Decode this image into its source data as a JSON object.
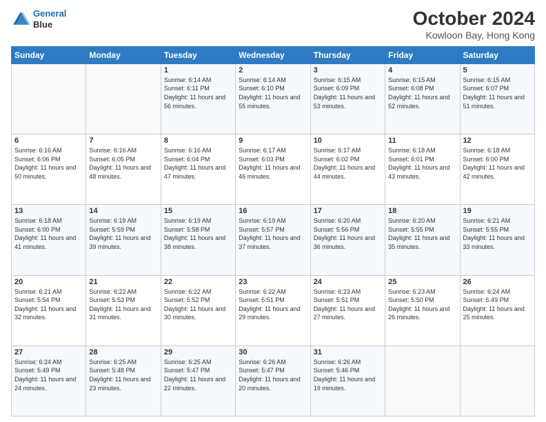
{
  "header": {
    "logo_line1": "General",
    "logo_line2": "Blue",
    "month_title": "October 2024",
    "location": "Kowloon Bay, Hong Kong"
  },
  "days_of_week": [
    "Sunday",
    "Monday",
    "Tuesday",
    "Wednesday",
    "Thursday",
    "Friday",
    "Saturday"
  ],
  "weeks": [
    [
      {
        "day": "",
        "info": ""
      },
      {
        "day": "",
        "info": ""
      },
      {
        "day": "1",
        "info": "Sunrise: 6:14 AM\nSunset: 6:11 PM\nDaylight: 11 hours and 56 minutes."
      },
      {
        "day": "2",
        "info": "Sunrise: 6:14 AM\nSunset: 6:10 PM\nDaylight: 11 hours and 55 minutes."
      },
      {
        "day": "3",
        "info": "Sunrise: 6:15 AM\nSunset: 6:09 PM\nDaylight: 11 hours and 53 minutes."
      },
      {
        "day": "4",
        "info": "Sunrise: 6:15 AM\nSunset: 6:08 PM\nDaylight: 11 hours and 52 minutes."
      },
      {
        "day": "5",
        "info": "Sunrise: 6:15 AM\nSunset: 6:07 PM\nDaylight: 11 hours and 51 minutes."
      }
    ],
    [
      {
        "day": "6",
        "info": "Sunrise: 6:16 AM\nSunset: 6:06 PM\nDaylight: 11 hours and 50 minutes."
      },
      {
        "day": "7",
        "info": "Sunrise: 6:16 AM\nSunset: 6:05 PM\nDaylight: 11 hours and 48 minutes."
      },
      {
        "day": "8",
        "info": "Sunrise: 6:16 AM\nSunset: 6:04 PM\nDaylight: 11 hours and 47 minutes."
      },
      {
        "day": "9",
        "info": "Sunrise: 6:17 AM\nSunset: 6:03 PM\nDaylight: 11 hours and 46 minutes."
      },
      {
        "day": "10",
        "info": "Sunrise: 6:17 AM\nSunset: 6:02 PM\nDaylight: 11 hours and 44 minutes."
      },
      {
        "day": "11",
        "info": "Sunrise: 6:18 AM\nSunset: 6:01 PM\nDaylight: 11 hours and 43 minutes."
      },
      {
        "day": "12",
        "info": "Sunrise: 6:18 AM\nSunset: 6:00 PM\nDaylight: 11 hours and 42 minutes."
      }
    ],
    [
      {
        "day": "13",
        "info": "Sunrise: 6:18 AM\nSunset: 6:00 PM\nDaylight: 11 hours and 41 minutes."
      },
      {
        "day": "14",
        "info": "Sunrise: 6:19 AM\nSunset: 5:59 PM\nDaylight: 11 hours and 39 minutes."
      },
      {
        "day": "15",
        "info": "Sunrise: 6:19 AM\nSunset: 5:58 PM\nDaylight: 11 hours and 38 minutes."
      },
      {
        "day": "16",
        "info": "Sunrise: 6:19 AM\nSunset: 5:57 PM\nDaylight: 11 hours and 37 minutes."
      },
      {
        "day": "17",
        "info": "Sunrise: 6:20 AM\nSunset: 5:56 PM\nDaylight: 11 hours and 36 minutes."
      },
      {
        "day": "18",
        "info": "Sunrise: 6:20 AM\nSunset: 5:55 PM\nDaylight: 11 hours and 35 minutes."
      },
      {
        "day": "19",
        "info": "Sunrise: 6:21 AM\nSunset: 5:55 PM\nDaylight: 11 hours and 33 minutes."
      }
    ],
    [
      {
        "day": "20",
        "info": "Sunrise: 6:21 AM\nSunset: 5:54 PM\nDaylight: 11 hours and 32 minutes."
      },
      {
        "day": "21",
        "info": "Sunrise: 6:22 AM\nSunset: 5:53 PM\nDaylight: 11 hours and 31 minutes."
      },
      {
        "day": "22",
        "info": "Sunrise: 6:22 AM\nSunset: 5:52 PM\nDaylight: 11 hours and 30 minutes."
      },
      {
        "day": "23",
        "info": "Sunrise: 6:22 AM\nSunset: 5:51 PM\nDaylight: 11 hours and 29 minutes."
      },
      {
        "day": "24",
        "info": "Sunrise: 6:23 AM\nSunset: 5:51 PM\nDaylight: 11 hours and 27 minutes."
      },
      {
        "day": "25",
        "info": "Sunrise: 6:23 AM\nSunset: 5:50 PM\nDaylight: 11 hours and 26 minutes."
      },
      {
        "day": "26",
        "info": "Sunrise: 6:24 AM\nSunset: 5:49 PM\nDaylight: 11 hours and 25 minutes."
      }
    ],
    [
      {
        "day": "27",
        "info": "Sunrise: 6:24 AM\nSunset: 5:49 PM\nDaylight: 11 hours and 24 minutes."
      },
      {
        "day": "28",
        "info": "Sunrise: 6:25 AM\nSunset: 5:48 PM\nDaylight: 11 hours and 23 minutes."
      },
      {
        "day": "29",
        "info": "Sunrise: 6:25 AM\nSunset: 5:47 PM\nDaylight: 11 hours and 22 minutes."
      },
      {
        "day": "30",
        "info": "Sunrise: 6:26 AM\nSunset: 5:47 PM\nDaylight: 11 hours and 20 minutes."
      },
      {
        "day": "31",
        "info": "Sunrise: 6:26 AM\nSunset: 5:46 PM\nDaylight: 11 hours and 19 minutes."
      },
      {
        "day": "",
        "info": ""
      },
      {
        "day": "",
        "info": ""
      }
    ]
  ]
}
